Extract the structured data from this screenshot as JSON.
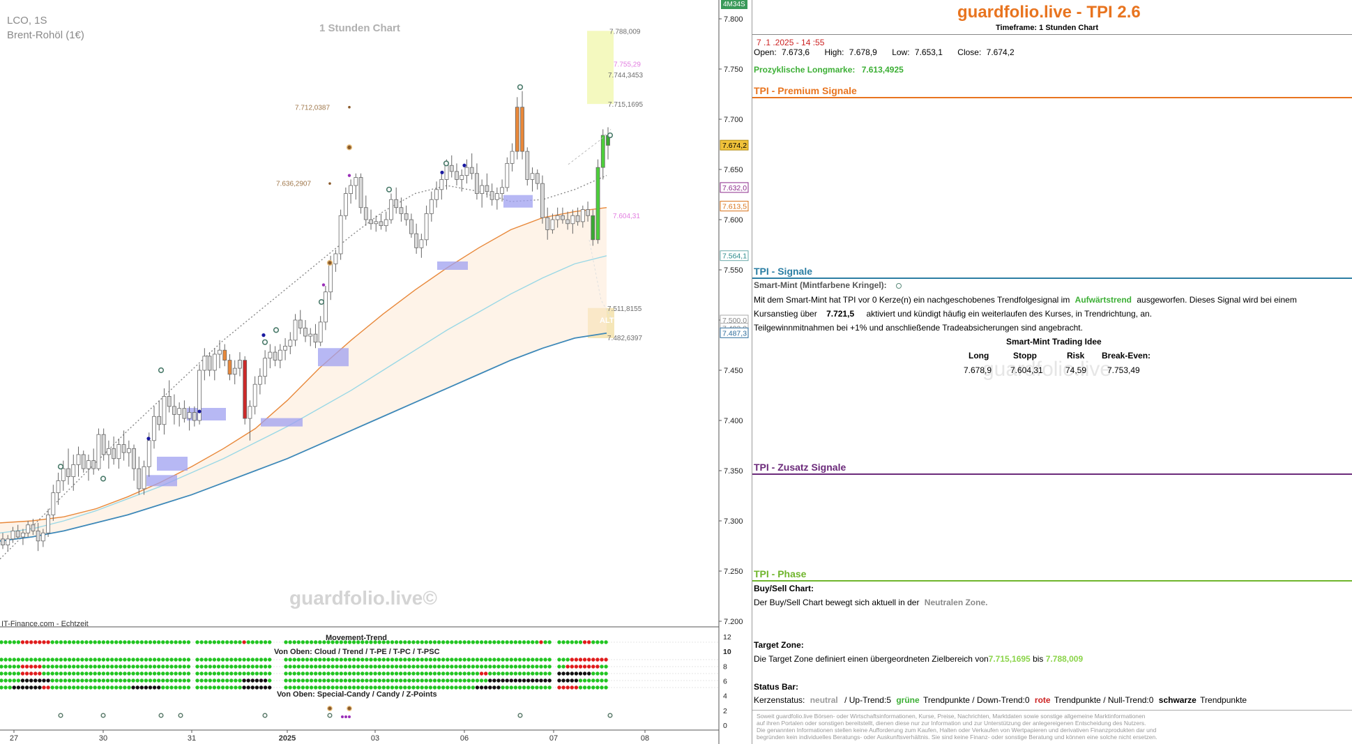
{
  "chart_data": {
    "type": "candlestick",
    "symbol_line": "LCO, 1S",
    "instrument": "Brent-Rohöl (1€)",
    "chart_title": "1 Stunden Chart",
    "watermark": "guardfolio.live©",
    "source": "IT-Finance.com - Echtzeit",
    "y_range": [
      7.2,
      7.8
    ],
    "y_ticks": [
      "7.800",
      "7.750",
      "7.700",
      "7.650",
      "7.600",
      "7.550",
      "7.500",
      "7.450",
      "7.400",
      "7.350",
      "7.300",
      "7.250",
      "7.200"
    ],
    "x_tick_labels": [
      "27",
      "30",
      "31",
      "2025",
      "03",
      "06",
      "07",
      "08"
    ],
    "timer_badge": "4M34S",
    "price_badges": [
      {
        "label": "7.674,2",
        "value": 7.6742,
        "style": "current"
      },
      {
        "label": "7.632,0",
        "value": 7.632,
        "style": "purple"
      },
      {
        "label": "7.613,5",
        "value": 7.6135,
        "style": "orange"
      },
      {
        "label": "7.564,1",
        "value": 7.5641,
        "style": "teal"
      },
      {
        "label": "7.500,0",
        "value": 7.5,
        "style": "gray"
      },
      {
        "label": "7.492,0",
        "value": 7.492,
        "style": "gray"
      },
      {
        "label": "7.487,3",
        "value": 7.4873,
        "style": "blue"
      }
    ],
    "annotations": [
      {
        "text": "7.788,009",
        "value": 7.788,
        "color": "#6d6d6d"
      },
      {
        "text": "7.755,29",
        "value": 7.7553,
        "color": "#e27de0"
      },
      {
        "text": "7.744,3453",
        "value": 7.7443,
        "color": "#6d6d6d"
      },
      {
        "text": "7.715,1695",
        "value": 7.7152,
        "color": "#6d6d6d"
      },
      {
        "text": "7.604,31",
        "value": 7.6043,
        "color": "#e27de0"
      },
      {
        "text": "7.511,8155",
        "value": 7.5118,
        "color": "#6d6d6d"
      },
      {
        "text": "7.482,6397",
        "value": 7.4826,
        "color": "#6d6d6d"
      },
      {
        "text": "7.712,0387",
        "value": 7.712,
        "color": "#a0784c"
      },
      {
        "text": "7.636,2907",
        "value": 7.6363,
        "color": "#a0784c"
      },
      {
        "text": "ALT",
        "value": 7.5,
        "color": "#ffffff"
      }
    ],
    "candles": [
      [
        7.282,
        7.288,
        7.272,
        7.276
      ],
      [
        7.276,
        7.286,
        7.27,
        7.282
      ],
      [
        7.282,
        7.294,
        7.278,
        7.29
      ],
      [
        7.29,
        7.296,
        7.282,
        7.284
      ],
      [
        7.284,
        7.292,
        7.276,
        7.288
      ],
      [
        7.288,
        7.3,
        7.284,
        7.296
      ],
      [
        7.296,
        7.302,
        7.286,
        7.29
      ],
      [
        7.29,
        7.298,
        7.27,
        7.28
      ],
      [
        7.28,
        7.292,
        7.274,
        7.288
      ],
      [
        7.288,
        7.312,
        7.284,
        7.306
      ],
      [
        7.306,
        7.336,
        7.3,
        7.328
      ],
      [
        7.328,
        7.348,
        7.316,
        7.34
      ],
      [
        7.34,
        7.36,
        7.33,
        7.352
      ],
      [
        7.352,
        7.372,
        7.336,
        7.344
      ],
      [
        7.344,
        7.366,
        7.33,
        7.356
      ],
      [
        7.356,
        7.374,
        7.344,
        7.366
      ],
      [
        7.366,
        7.37,
        7.348,
        7.352
      ],
      [
        7.352,
        7.366,
        7.34,
        7.36
      ],
      [
        7.36,
        7.372,
        7.346,
        7.352
      ],
      [
        7.352,
        7.392,
        7.35,
        7.386
      ],
      [
        7.386,
        7.392,
        7.36,
        7.366
      ],
      [
        7.366,
        7.38,
        7.352,
        7.372
      ],
      [
        7.372,
        7.384,
        7.356,
        7.362
      ],
      [
        7.362,
        7.382,
        7.352,
        7.376
      ],
      [
        7.376,
        7.39,
        7.36,
        7.368
      ],
      [
        7.368,
        7.38,
        7.354,
        7.372
      ],
      [
        7.372,
        7.376,
        7.34,
        7.352
      ],
      [
        7.352,
        7.364,
        7.326,
        7.332
      ],
      [
        7.332,
        7.36,
        7.326,
        7.354
      ],
      [
        7.354,
        7.388,
        7.344,
        7.38
      ],
      [
        7.38,
        7.414,
        7.372,
        7.404
      ],
      [
        7.404,
        7.42,
        7.39,
        7.396
      ],
      [
        7.396,
        7.432,
        7.386,
        7.424
      ],
      [
        7.424,
        7.44,
        7.408,
        7.414
      ],
      [
        7.414,
        7.426,
        7.396,
        7.406
      ],
      [
        7.406,
        7.418,
        7.394,
        7.412
      ],
      [
        7.412,
        7.42,
        7.398,
        7.402
      ],
      [
        7.402,
        7.414,
        7.39,
        7.408
      ],
      [
        7.408,
        7.414,
        7.394,
        7.4
      ],
      [
        7.4,
        7.456,
        7.396,
        7.45
      ],
      [
        7.45,
        7.472,
        7.44,
        7.464
      ],
      [
        7.464,
        7.468,
        7.444,
        7.45
      ],
      [
        7.45,
        7.472,
        7.44,
        7.466
      ],
      [
        7.466,
        7.48,
        7.452,
        7.47
      ],
      [
        7.47,
        7.476,
        7.454,
        7.46
      ],
      [
        7.46,
        7.466,
        7.44,
        7.446
      ],
      [
        7.446,
        7.46,
        7.436,
        7.452
      ],
      [
        7.452,
        7.468,
        7.444,
        7.46
      ],
      [
        7.46,
        7.464,
        7.396,
        7.402
      ],
      [
        7.402,
        7.42,
        7.38,
        7.414
      ],
      [
        7.414,
        7.444,
        7.406,
        7.436
      ],
      [
        7.436,
        7.452,
        7.426,
        7.444
      ],
      [
        7.444,
        7.47,
        7.436,
        7.462
      ],
      [
        7.462,
        7.476,
        7.452,
        7.468
      ],
      [
        7.468,
        7.474,
        7.454,
        7.46
      ],
      [
        7.46,
        7.476,
        7.452,
        7.47
      ],
      [
        7.47,
        7.482,
        7.46,
        7.474
      ],
      [
        7.474,
        7.488,
        7.466,
        7.48
      ],
      [
        7.48,
        7.506,
        7.474,
        7.5
      ],
      [
        7.5,
        7.51,
        7.486,
        7.492
      ],
      [
        7.492,
        7.5,
        7.478,
        7.484
      ],
      [
        7.484,
        7.492,
        7.474,
        7.486
      ],
      [
        7.486,
        7.496,
        7.472,
        7.478
      ],
      [
        7.478,
        7.504,
        7.474,
        7.498
      ],
      [
        7.498,
        7.534,
        7.49,
        7.528
      ],
      [
        7.528,
        7.564,
        7.52,
        7.556
      ],
      [
        7.556,
        7.57,
        7.548,
        7.566
      ],
      [
        7.566,
        7.61,
        7.56,
        7.604
      ],
      [
        7.604,
        7.632,
        7.6,
        7.626
      ],
      [
        7.626,
        7.64,
        7.616,
        7.634
      ],
      [
        7.634,
        7.646,
        7.62,
        7.642
      ],
      [
        7.642,
        7.646,
        7.606,
        7.612
      ],
      [
        7.612,
        7.624,
        7.594,
        7.6
      ],
      [
        7.6,
        7.61,
        7.59,
        7.596
      ],
      [
        7.596,
        7.604,
        7.588,
        7.598
      ],
      [
        7.598,
        7.606,
        7.59,
        7.594
      ],
      [
        7.594,
        7.608,
        7.588,
        7.6
      ],
      [
        7.6,
        7.626,
        7.596,
        7.62
      ],
      [
        7.62,
        7.632,
        7.606,
        7.612
      ],
      [
        7.612,
        7.622,
        7.598,
        7.606
      ],
      [
        7.606,
        7.614,
        7.594,
        7.6
      ],
      [
        7.6,
        7.606,
        7.582,
        7.586
      ],
      [
        7.586,
        7.596,
        7.566,
        7.572
      ],
      [
        7.572,
        7.586,
        7.562,
        7.58
      ],
      [
        7.58,
        7.614,
        7.574,
        7.606
      ],
      [
        7.606,
        7.628,
        7.598,
        7.62
      ],
      [
        7.62,
        7.638,
        7.612,
        7.63
      ],
      [
        7.63,
        7.646,
        7.62,
        7.64
      ],
      [
        7.64,
        7.66,
        7.63,
        7.654
      ],
      [
        7.654,
        7.664,
        7.642,
        7.648
      ],
      [
        7.648,
        7.656,
        7.634,
        7.64
      ],
      [
        7.64,
        7.65,
        7.628,
        7.644
      ],
      [
        7.644,
        7.66,
        7.636,
        7.652
      ],
      [
        7.652,
        7.666,
        7.64,
        7.646
      ],
      [
        7.646,
        7.656,
        7.62,
        7.626
      ],
      [
        7.626,
        7.64,
        7.612,
        7.634
      ],
      [
        7.634,
        7.646,
        7.622,
        7.628
      ],
      [
        7.628,
        7.636,
        7.614,
        7.62
      ],
      [
        7.62,
        7.632,
        7.61,
        7.626
      ],
      [
        7.626,
        7.64,
        7.618,
        7.632
      ],
      [
        7.632,
        7.662,
        7.628,
        7.656
      ],
      [
        7.656,
        7.676,
        7.648,
        7.668
      ],
      [
        7.668,
        7.722,
        7.66,
        7.712
      ],
      [
        7.712,
        7.728,
        7.66,
        7.668
      ],
      [
        7.668,
        7.672,
        7.634,
        7.64
      ],
      [
        7.64,
        7.652,
        7.628,
        7.646
      ],
      [
        7.646,
        7.65,
        7.63,
        7.636
      ],
      [
        7.636,
        7.644,
        7.596,
        7.602
      ],
      [
        7.602,
        7.612,
        7.58,
        7.59
      ],
      [
        7.59,
        7.606,
        7.586,
        7.6
      ],
      [
        7.6,
        7.612,
        7.592,
        7.604
      ],
      [
        7.604,
        7.612,
        7.596,
        7.6
      ],
      [
        7.6,
        7.608,
        7.59,
        7.596
      ],
      [
        7.596,
        7.61,
        7.586,
        7.604
      ],
      [
        7.604,
        7.612,
        7.594,
        7.598
      ],
      [
        7.598,
        7.614,
        7.592,
        7.61
      ],
      [
        7.61,
        7.618,
        7.598,
        7.604
      ],
      [
        7.604,
        7.61,
        7.574,
        7.58
      ],
      [
        7.58,
        7.66,
        7.576,
        7.652
      ],
      [
        7.652,
        7.69,
        7.64,
        7.684
      ],
      [
        7.684,
        7.692,
        7.66,
        7.674
      ]
    ],
    "lines": [
      {
        "name": "",
        "color": "#888888",
        "style": "dotted",
        "values": [
          7.262,
          7.294,
          7.326,
          7.358,
          7.39,
          7.42,
          7.45,
          7.48,
          7.506,
          7.532,
          7.558,
          7.584,
          7.608,
          7.626,
          7.634,
          7.628,
          7.618,
          7.62,
          7.63,
          7.644
        ]
      },
      {
        "name": "",
        "color": "#e8883a",
        "style": "solid",
        "values": [
          7.298,
          7.3,
          7.304,
          7.312,
          7.324,
          7.338,
          7.354,
          7.372,
          7.392,
          7.42,
          7.452,
          7.48,
          7.506,
          7.53,
          7.552,
          7.572,
          7.59,
          7.602,
          7.608,
          7.612
        ]
      },
      {
        "name": "",
        "color": "#9ad8e6",
        "style": "solid",
        "values": [
          7.288,
          7.292,
          7.3,
          7.31,
          7.322,
          7.334,
          7.348,
          7.362,
          7.378,
          7.394,
          7.412,
          7.43,
          7.45,
          7.47,
          7.49,
          7.508,
          7.526,
          7.542,
          7.556,
          7.564
        ]
      },
      {
        "name": "",
        "color": "#3d88b8",
        "style": "solid",
        "values": [
          7.28,
          7.284,
          7.29,
          7.298,
          7.306,
          7.316,
          7.326,
          7.338,
          7.35,
          7.362,
          7.376,
          7.39,
          7.404,
          7.418,
          7.432,
          7.446,
          7.46,
          7.472,
          7.482,
          7.487
        ]
      }
    ],
    "indicator": {
      "title": "Movement-Trend",
      "subtitle_top": "Von Oben: Cloud / Trend / T-PE / T-PC / T-PSC",
      "subtitle_bottom": "Von Oben: Special-Candy / Candy / Z-Points",
      "y_ticks": [
        "12",
        "10",
        "8",
        "6",
        "4",
        "2",
        "0"
      ]
    }
  },
  "right_panel": {
    "title": "guardfolio.live - TPI 2.6",
    "timeframe": "Timeframe: 1 Stunden Chart",
    "datetime": "7 .1 .2025 - 14 :55",
    "ohlc": {
      "open_label": "Open:",
      "open": "7.673,6",
      "high_label": "High:",
      "high": "7.678,9",
      "low_label": "Low:",
      "low": "7.653,1",
      "close_label": "Close:",
      "close": "7.674,2"
    },
    "longmarke_label": "Prozyklische Longmarke:",
    "longmarke_value": "7.613,4925",
    "premium_title": "TPI - Premium Signale",
    "signale_title": "TPI - Signale",
    "smartmint_label": "Smart-Mint (Mintfarbene Kringel):",
    "signal_text_1a": "Mit dem Smart-Mint hat TPI vor 0  Kerze(n) ein nachgeschobenes Trendfolgesignal im",
    "signal_trend_word": "Aufwärtstrend",
    "signal_text_1b": "ausgeworfen. Dieses Signal wird bei einem",
    "signal_text_2a": "Kursanstieg über",
    "signal_trigger": "7.721,5",
    "signal_text_2b": "aktiviert und kündigt häufig ein weiterlaufen des Kurses, in Trendrichtung, an.",
    "signal_text_3": "Teilgewinnmitnahmen bei +1% und anschließende Tradeabsicherungen sind angebracht.",
    "idea_title": "Smart-Mint Trading Idee",
    "idea_headers": [
      "Long",
      "Stopp",
      "Risk",
      "Break-Even:"
    ],
    "idea_values": [
      "7.678,9",
      "7.604,31",
      "74,59",
      "7.753,49"
    ],
    "watermark": "guardfolio.live",
    "zusatz_title": "TPI - Zusatz Signale",
    "phase_title": "TPI - Phase",
    "buysell_label": "Buy/Sell Chart:",
    "buysell_text": "Der Buy/Sell Chart bewegt sich aktuell in der",
    "buysell_zone": "Neutralen Zone.",
    "target_label": "Target Zone:",
    "target_text": "Die Target Zone definiert einen übergeordneten Zielbereich von",
    "target_from": "7.715,1695",
    "target_mid": "bis",
    "target_to": "7.788,009",
    "status_label": "Status Bar:",
    "status_kerzen": "Kerzenstatus:",
    "status_neutral": "neutral",
    "status_up": "/ Up-Trend:5",
    "status_green": "grüne",
    "status_tp1": "Trendpunkte  / Down-Trend:0",
    "status_red": "rote",
    "status_tp2": "Trendpunkte / Null-Trend:0",
    "status_black": "schwarze",
    "status_tp3": "Trendpunkte",
    "disclaimer": [
      "Soweit guardfolio.live Börsen- oder Wirtschaftsinformationen, Kurse, Preise, Nachrichten, Marktdaten sowie sonstige allgemeine Marktinformationen",
      "auf ihren Portalen oder sonstigen bereitstellt, dienen diese nur zur Information und zur Unterstützung der anlegereigenen Entscheidung des Nutzers.",
      "Die genannten Informationen stellen keine Aufforderung zum Kaufen, Halten oder Verkaufen von Wertpapieren und derivativen Finanzprodukten dar und",
      "begründen kein individuelles Beratungs- oder Auskunftsverhältnis. Sie sind keine Finanz- oder sonstige Beratung und können eine solche nicht ersetzen."
    ],
    "colors": {
      "orange": "#e8741f",
      "premium_line": "#e8741f",
      "signale_line": "#2b7ea3",
      "zusatz_line": "#6b2a7a",
      "phase_line": "#6fb52c",
      "green": "#3caf35",
      "red": "#cc2222"
    }
  }
}
